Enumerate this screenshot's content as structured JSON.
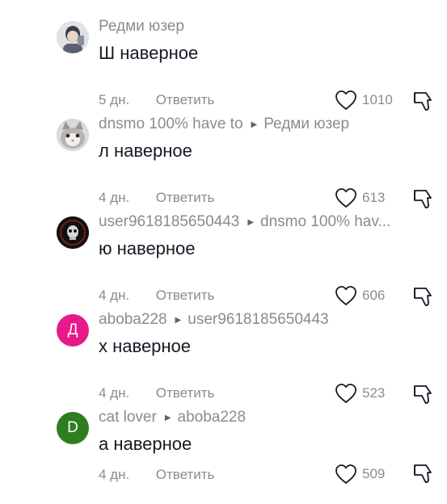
{
  "comments": [
    {
      "author": "Редми юзер",
      "reply_to": "",
      "text": "Ш наверное",
      "date": "5 дн.",
      "reply_label": "Ответить",
      "likes": "1010",
      "avatar_letter": "",
      "avatar_color": "#c9ccd1"
    },
    {
      "author": "dnsmo 100% have to",
      "reply_to": "Редми юзер",
      "text": "л наверное",
      "date": "4 дн.",
      "reply_label": "Ответить",
      "likes": "613",
      "avatar_letter": "",
      "avatar_color": "#9aa0a6"
    },
    {
      "author": "user9618185650443",
      "reply_to": "dnsmo 100% hav...",
      "text": "ю наверное",
      "date": "4 дн.",
      "reply_label": "Ответить",
      "likes": "606",
      "avatar_letter": "",
      "avatar_color": "#1a1a1a"
    },
    {
      "author": "aboba228",
      "reply_to": "user9618185650443",
      "text": "х наверное",
      "date": "4 дн.",
      "reply_label": "Ответить",
      "likes": "523",
      "avatar_letter": "Д",
      "avatar_color": "#e8198b"
    },
    {
      "author": "cat lover",
      "reply_to": "aboba228",
      "text": "а наверное",
      "date": "4 дн.",
      "reply_label": "Ответить",
      "likes": "509",
      "avatar_letter": "D",
      "avatar_color": "#2e7d1f"
    }
  ],
  "icons": {
    "like": "heart-outline-icon",
    "dislike": "thumbs-down-outline-icon",
    "reply_arrow": "triangle-right-icon"
  }
}
